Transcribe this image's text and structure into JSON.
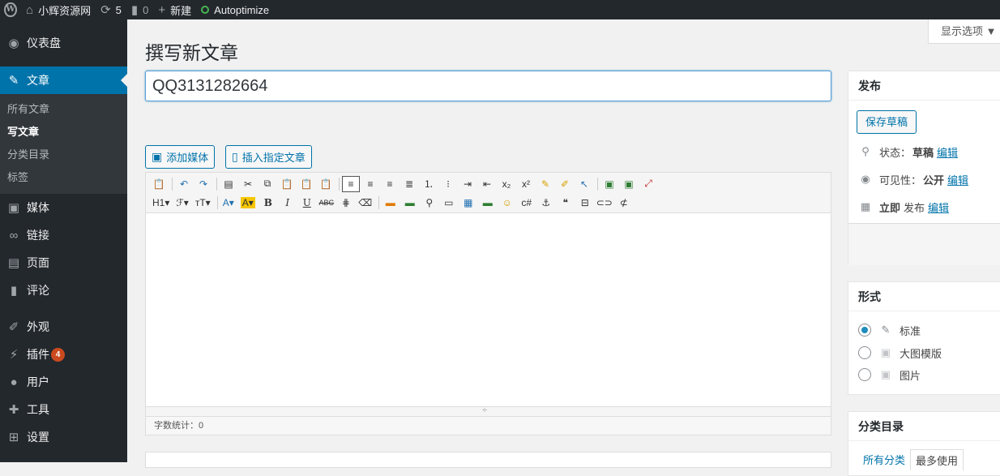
{
  "adminbar": {
    "site_name": "小辉资源网",
    "updates_count": "5",
    "comments_count": "0",
    "new_label": "新建",
    "plugin_label": "Autoptimize"
  },
  "sidebar": {
    "items": [
      {
        "label": "仪表盘",
        "icon": "dashboard-icon"
      },
      {
        "label": "文章",
        "icon": "pin-icon"
      },
      {
        "label": "媒体",
        "icon": "media-icon"
      },
      {
        "label": "链接",
        "icon": "link-icon"
      },
      {
        "label": "页面",
        "icon": "page-icon"
      },
      {
        "label": "评论",
        "icon": "comment-icon"
      },
      {
        "label": "外观",
        "icon": "brush-icon"
      },
      {
        "label": "插件",
        "icon": "plugin-icon",
        "badge": "4"
      },
      {
        "label": "用户",
        "icon": "user-icon"
      },
      {
        "label": "工具",
        "icon": "wrench-icon"
      },
      {
        "label": "设置",
        "icon": "settings-icon"
      }
    ],
    "submenu": [
      "所有文章",
      "写文章",
      "分类目录",
      "标签"
    ]
  },
  "main": {
    "screen_options": "显示选项 ▼",
    "page_title": "撰写新文章",
    "title_value": "QQ3131282664",
    "add_media": "添加媒体",
    "insert_post": "插入指定文章",
    "word_count": "字数统计：0"
  },
  "toolbar": {
    "heading": "H1▾",
    "font": "ℱ▾",
    "size": "тT▾",
    "color": "A▾",
    "bg": "A▾",
    "bold": "B",
    "italic": "I",
    "underline": "U",
    "strike": "ABC"
  },
  "publish": {
    "title": "发布",
    "save_draft": "保存草稿",
    "status_label": "状态：",
    "status_value": "草稿",
    "visibility_label": "可见性：",
    "visibility_value": "公开",
    "schedule_label": "立即",
    "schedule_suffix": "发布",
    "edit": "编辑"
  },
  "format": {
    "title": "形式",
    "options": [
      "标准",
      "大图模版",
      "图片"
    ]
  },
  "categories": {
    "title": "分类目录",
    "tab_all": "所有分类",
    "tab_popular": "最多使用"
  }
}
